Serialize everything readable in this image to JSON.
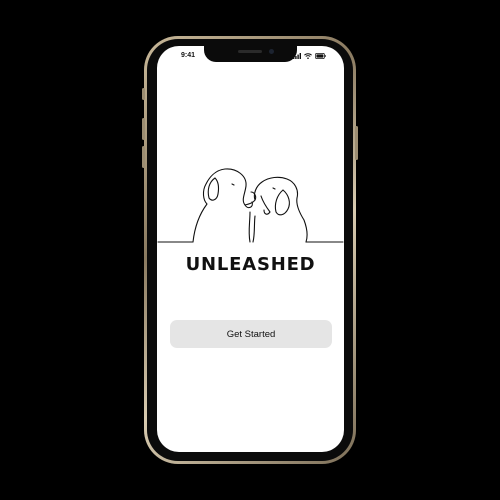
{
  "status_bar": {
    "time": "9:41",
    "icons": [
      "signal-icon",
      "wifi-icon",
      "battery-icon"
    ]
  },
  "app": {
    "illustration": "two-dogs-line-art-icon",
    "title": "UNLEASHED",
    "cta_label": "Get Started"
  },
  "colors": {
    "background": "#000000",
    "screen": "#ffffff",
    "button": "#e5e5e5",
    "text": "#111111",
    "frame": "#c9b99a"
  }
}
